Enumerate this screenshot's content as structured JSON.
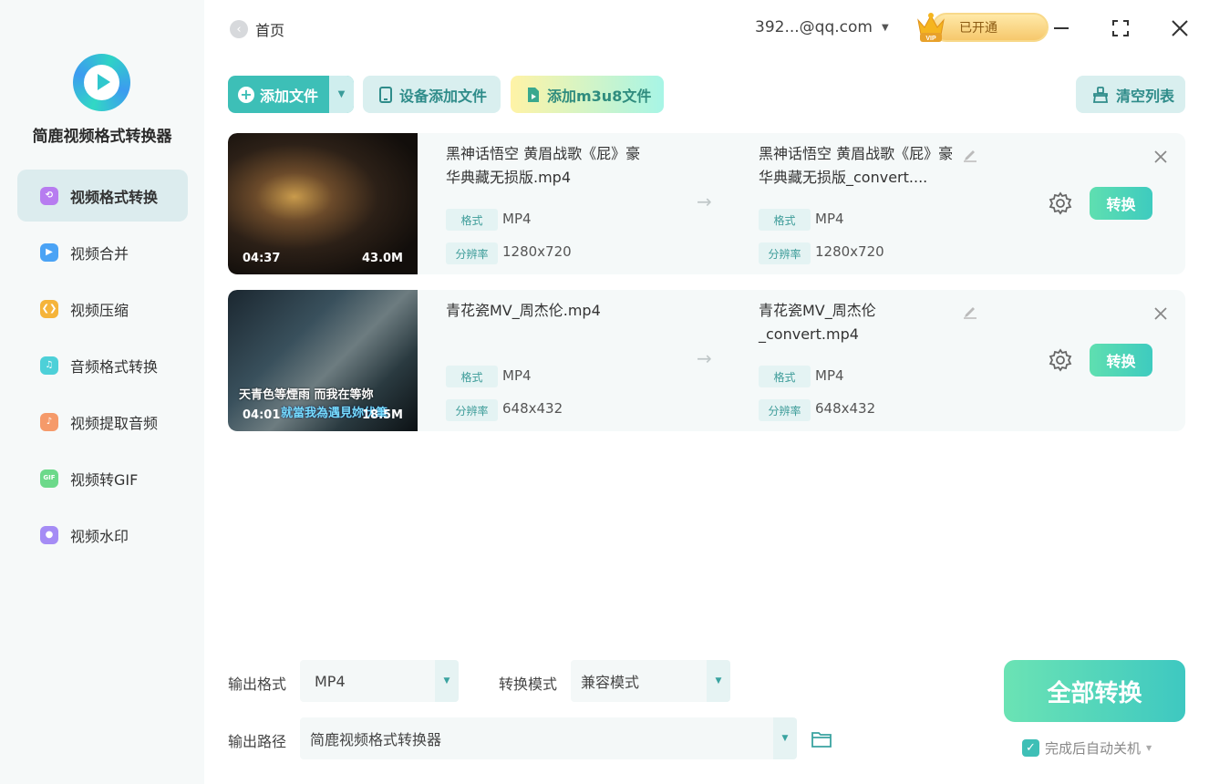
{
  "app": {
    "title": "简鹿视频格式转换器",
    "accent": "#3dbfb7"
  },
  "sidebar": {
    "items": [
      {
        "label": "视频格式转换",
        "icon": "video-convert-icon",
        "color": "#b77cf0",
        "active": true
      },
      {
        "label": "视频合并",
        "icon": "video-merge-icon",
        "color": "#4aa3f5",
        "active": false
      },
      {
        "label": "视频压缩",
        "icon": "video-compress-icon",
        "color": "#f5b43a",
        "active": false
      },
      {
        "label": "音频格式转换",
        "icon": "audio-convert-icon",
        "color": "#4dd0d8",
        "active": false
      },
      {
        "label": "视频提取音频",
        "icon": "extract-audio-icon",
        "color": "#f59a6a",
        "active": false
      },
      {
        "label": "视频转GIF",
        "icon": "gif-icon",
        "color": "#6cd98a",
        "active": false
      },
      {
        "label": "视频水印",
        "icon": "watermark-icon",
        "color": "#a58cf5",
        "active": false
      }
    ]
  },
  "topbar": {
    "home_label": "首页",
    "account": "392...@qq.com",
    "vip_label": "已开通",
    "vip_badge": "VIP"
  },
  "toolbar": {
    "add_file": "添加文件",
    "device_add": "设备添加文件",
    "add_m3u8": "添加m3u8文件",
    "clear_list": "清空列表"
  },
  "files": [
    {
      "duration": "04:37",
      "size": "43.0M",
      "source_name": "黑神话悟空 黄眉战歌《屁》豪华典藏无损版.mp4",
      "output_name": "黑神话悟空 黄眉战歌《屁》豪华典藏无损版_convert....",
      "format_tag": "格式",
      "resolution_tag": "分辨率",
      "src_format": "MP4",
      "src_resolution": "1280x720",
      "out_format": "MP4",
      "out_resolution": "1280x720",
      "convert_label": "转换",
      "subtitle_1": "",
      "subtitle_2": ""
    },
    {
      "duration": "04:01",
      "size": "18.5M",
      "source_name": "青花瓷MV_周杰伦.mp4",
      "output_name": "青花瓷MV_周杰伦_convert.mp4",
      "format_tag": "格式",
      "resolution_tag": "分辨率",
      "src_format": "MP4",
      "src_resolution": "648x432",
      "out_format": "MP4",
      "out_resolution": "648x432",
      "convert_label": "转换",
      "subtitle_1": "天青色等煙雨 而我在等妳",
      "subtitle_2": "就當我為遇見妳伏筆"
    }
  ],
  "bottom": {
    "output_format_label": "输出格式",
    "output_format_value": "MP4",
    "mode_label": "转换模式",
    "mode_value": "兼容模式",
    "path_label": "输出路径",
    "path_value": "简鹿视频格式转换器",
    "convert_all": "全部转换",
    "auto_shutdown": "完成后自动关机"
  }
}
